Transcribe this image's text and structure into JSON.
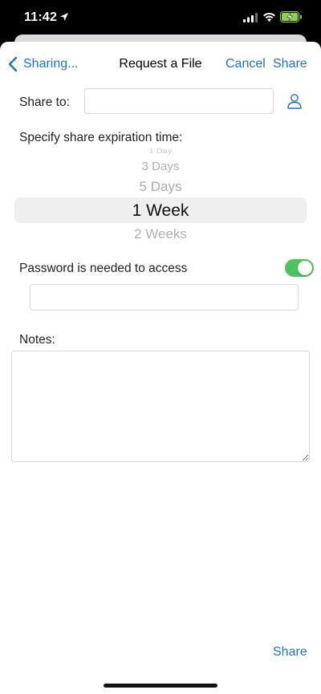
{
  "status_bar": {
    "time": "11:42"
  },
  "nav": {
    "back_label": "Sharing...",
    "title": "Request a File",
    "cancel_label": "Cancel",
    "share_label": "Share"
  },
  "form": {
    "share_to_label": "Share to:",
    "share_to_value": "",
    "expiration_label": "Specify share expiration time:",
    "expiration_options": [
      "1 Day",
      "3 Days",
      "5 Days",
      "1 Week",
      "2 Weeks"
    ],
    "expiration_selected": "1 Week",
    "password_label": "Password is needed to access",
    "password_required": true,
    "password_value": "",
    "notes_label": "Notes:",
    "notes_value": ""
  },
  "footer": {
    "share_label": "Share"
  },
  "colors": {
    "accent": "#1f72c9",
    "toggle_on": "#4cc35e"
  },
  "icons": [
    "location-arrow-icon",
    "cellular-signal-icon",
    "wifi-icon",
    "battery-charging-icon",
    "chevron-left-icon",
    "contact-person-icon"
  ]
}
